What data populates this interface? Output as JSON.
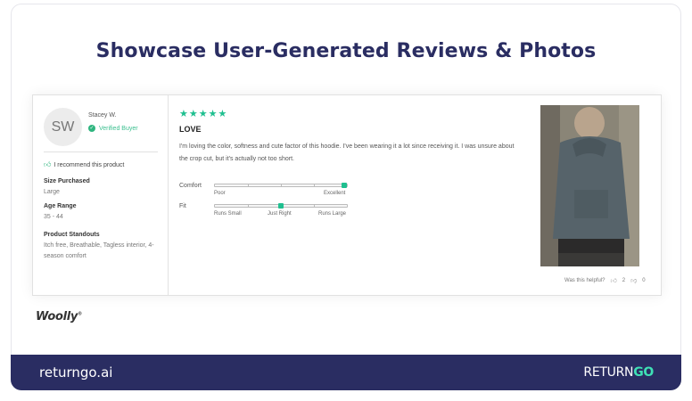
{
  "headline": "Showcase User-Generated Reviews & Photos",
  "review": {
    "avatar_initials": "SW",
    "reviewer_name": "Stacey W.",
    "verified_label": "Verified Buyer",
    "recommend_label": "I recommend this product",
    "attributes": [
      {
        "label": "Size Purchased",
        "value": "Large"
      },
      {
        "label": "Age Range",
        "value": "35 - 44"
      },
      {
        "label": "Product Standouts",
        "value": "Itch free, Breathable, Tagless interior, 4-season comfort"
      }
    ],
    "rating_stars": "★★★★★",
    "rating": 5,
    "title": "LOVE",
    "body": "I'm loving the color, softness and cute factor of this hoodie. I've been wearing it a lot since receiving it. I was unsure about the crop cut, but it's actually not too short.",
    "scales": [
      {
        "label": "Comfort",
        "low": "Poor",
        "mid": "",
        "high": "Excellent",
        "value_fraction": 1.0
      },
      {
        "label": "Fit",
        "low": "Runs Small",
        "mid": "Just Right",
        "high": "Runs Large",
        "value_fraction": 0.5
      }
    ],
    "helpful_label": "Was this helpful?",
    "helpful_yes": "2",
    "helpful_no": "0"
  },
  "brand": {
    "logo_text": "Woolly",
    "logo_mark": "®"
  },
  "footer": {
    "url": "returngo.ai",
    "brand_left": "RETURN",
    "brand_right": "GO"
  },
  "colors": {
    "accent": "#1fbf8f",
    "navy": "#2a2d62",
    "brand_green": "#3fe0b5"
  },
  "icons": [
    "check-circle-icon",
    "thumbs-up-icon",
    "thumbs-down-icon",
    "star-icon"
  ]
}
